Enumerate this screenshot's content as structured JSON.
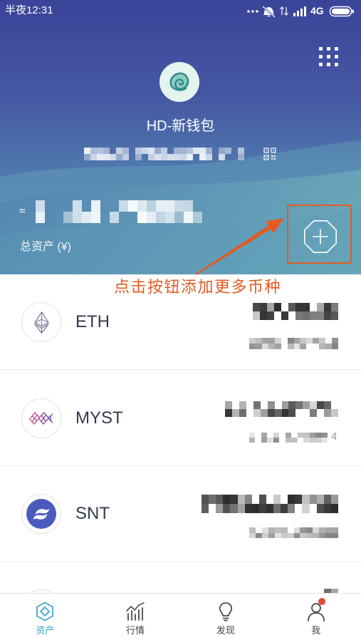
{
  "status_bar": {
    "time": "半夜12:31",
    "network": "4G"
  },
  "header": {
    "wallet_name": "HD-新钱包",
    "approx_symbol": "≈",
    "total_assets_label": "总资产 (¥)",
    "menu_icon": "grid-menu-icon",
    "add_icon": "add-token-icon",
    "qr_icon": "qr-code-icon"
  },
  "annotation": {
    "text": "点击按钮添加更多币种"
  },
  "tokens": [
    {
      "symbol": "ETH",
      "icon": "eth-icon"
    },
    {
      "symbol": "MYST",
      "icon": "myst-icon",
      "secondary_suffix": "4"
    },
    {
      "symbol": "SNT",
      "icon": "snt-icon"
    }
  ],
  "tabs": [
    {
      "label": "资产",
      "icon": "assets-icon",
      "active": true,
      "badge": false
    },
    {
      "label": "行情",
      "icon": "market-chart-icon",
      "active": false,
      "badge": false
    },
    {
      "label": "发现",
      "icon": "lightbulb-icon",
      "active": false,
      "badge": false
    },
    {
      "label": "我",
      "icon": "profile-icon",
      "active": false,
      "badge": true
    }
  ],
  "colors": {
    "accent": "#3fa7c8",
    "annotation": "#e35b22",
    "badge": "#e5483a",
    "header_top": "#3a4499",
    "header_bottom": "#5b93b3"
  }
}
